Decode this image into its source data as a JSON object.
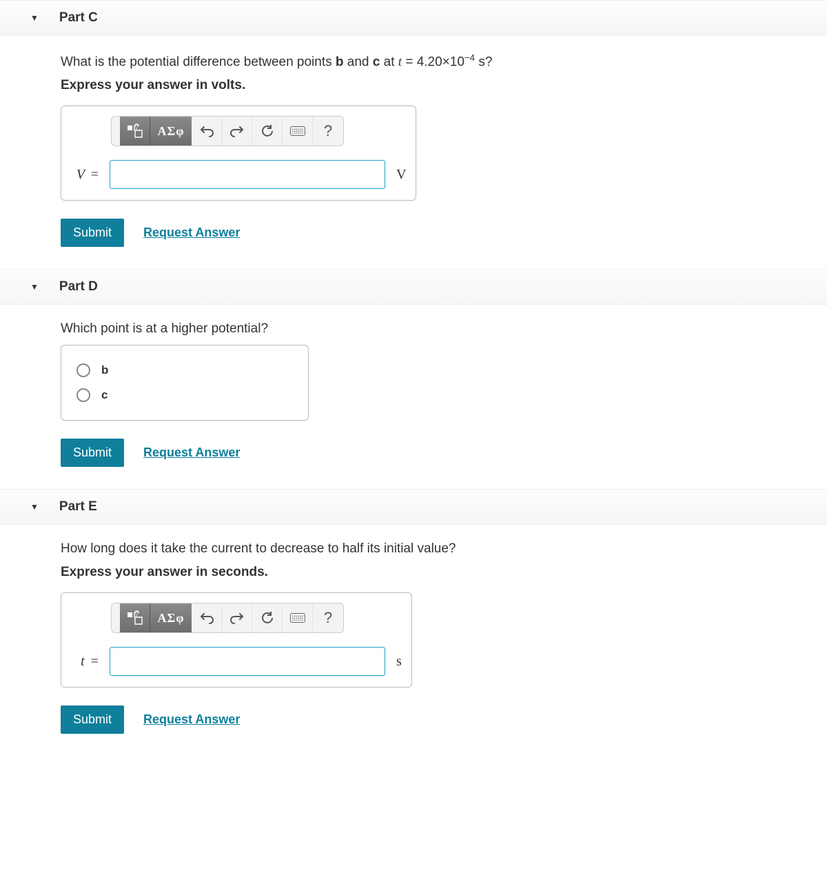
{
  "toolbar": {
    "greek_label": "ΑΣφ",
    "help_label": "?"
  },
  "buttons": {
    "submit": "Submit",
    "request": "Request Answer"
  },
  "partC": {
    "title": "Part C",
    "question_pre": "What is the potential difference between points ",
    "point_b": "b",
    "question_mid1": " and ",
    "point_c": "c",
    "question_mid2": " at ",
    "t_var": "t",
    "eq": " = ",
    "value_coef": "4.20×10",
    "value_exp": "−4",
    "value_unit": " s?",
    "instruction": "Express your answer in volts.",
    "var": "V",
    "eq_sign": "=",
    "unit": "V"
  },
  "partD": {
    "title": "Part D",
    "question": "Which point is at a higher potential?",
    "options": [
      "b",
      "c"
    ]
  },
  "partE": {
    "title": "Part E",
    "question": "How long does it take the current to decrease to half its initial value?",
    "instruction": "Express your answer in seconds.",
    "var": "t",
    "eq_sign": "=",
    "unit": "s"
  }
}
